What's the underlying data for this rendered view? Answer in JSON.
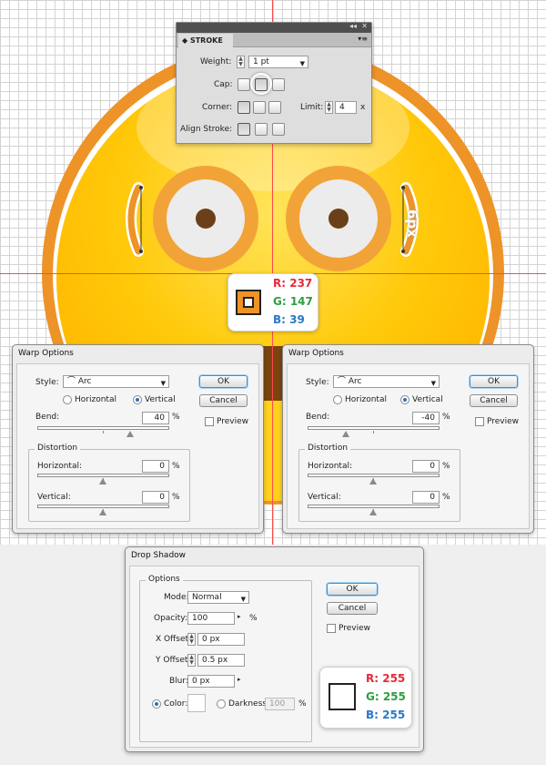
{
  "colors": {
    "face_outer": "#ED9327",
    "face_inner": "#FFC000",
    "red_text": "#e8283a",
    "green_text": "#2f9e41",
    "blue_text": "#2b78c9",
    "guide": "#ff4a4a",
    "button_focus": "#3d8fd1"
  },
  "stroke_panel": {
    "title": "STROKE",
    "weight_label": "Weight:",
    "weight_value": "1 pt",
    "cap_label": "Cap:",
    "corner_label": "Corner:",
    "limit_label": "Limit:",
    "limit_value": "4",
    "limit_unit": "x",
    "align_label": "Align Stroke:",
    "collapse_icon": "double-chevron-left-icon",
    "close_icon": "close-icon"
  },
  "annotation": {
    "measure": "6px"
  },
  "color_callout_1": {
    "r": "R: 237",
    "g": "G: 147",
    "b": "B: 39"
  },
  "warp_left": {
    "title": "Warp Options",
    "style_label": "Style:",
    "style_value": "Arc",
    "horizontal_label": "Horizontal",
    "vertical_label": "Vertical",
    "orientation": "Vertical",
    "bend_label": "Bend:",
    "bend_value": "40",
    "percent": "%",
    "distortion_title": "Distortion",
    "horizontal_dist_label": "Horizontal:",
    "horizontal_dist_value": "0",
    "vertical_dist_label": "Vertical:",
    "vertical_dist_value": "0",
    "ok": "OK",
    "cancel": "Cancel",
    "preview": "Preview"
  },
  "warp_right": {
    "title": "Warp Options",
    "style_label": "Style:",
    "style_value": "Arc",
    "horizontal_label": "Horizontal",
    "vertical_label": "Vertical",
    "orientation": "Vertical",
    "bend_label": "Bend:",
    "bend_value": "-40",
    "percent": "%",
    "distortion_title": "Distortion",
    "horizontal_dist_label": "Horizontal:",
    "horizontal_dist_value": "0",
    "vertical_dist_label": "Vertical:",
    "vertical_dist_value": "0",
    "ok": "OK",
    "cancel": "Cancel",
    "preview": "Preview"
  },
  "drop_shadow": {
    "title": "Drop Shadow",
    "options_title": "Options",
    "mode_label": "Mode:",
    "mode_value": "Normal",
    "opacity_label": "Opacity:",
    "opacity_value": "100",
    "percent": "%",
    "x_offset_label": "X Offset:",
    "x_offset_value": "0 px",
    "y_offset_label": "Y Offset:",
    "y_offset_value": "0.5 px",
    "blur_label": "Blur:",
    "blur_value": "0 px",
    "color_label": "Color:",
    "darkness_label": "Darkness:",
    "darkness_value": "100",
    "ok": "OK",
    "cancel": "Cancel",
    "preview": "Preview"
  },
  "color_callout_2": {
    "r": "R: 255",
    "g": "G: 255",
    "b": "B: 255"
  }
}
